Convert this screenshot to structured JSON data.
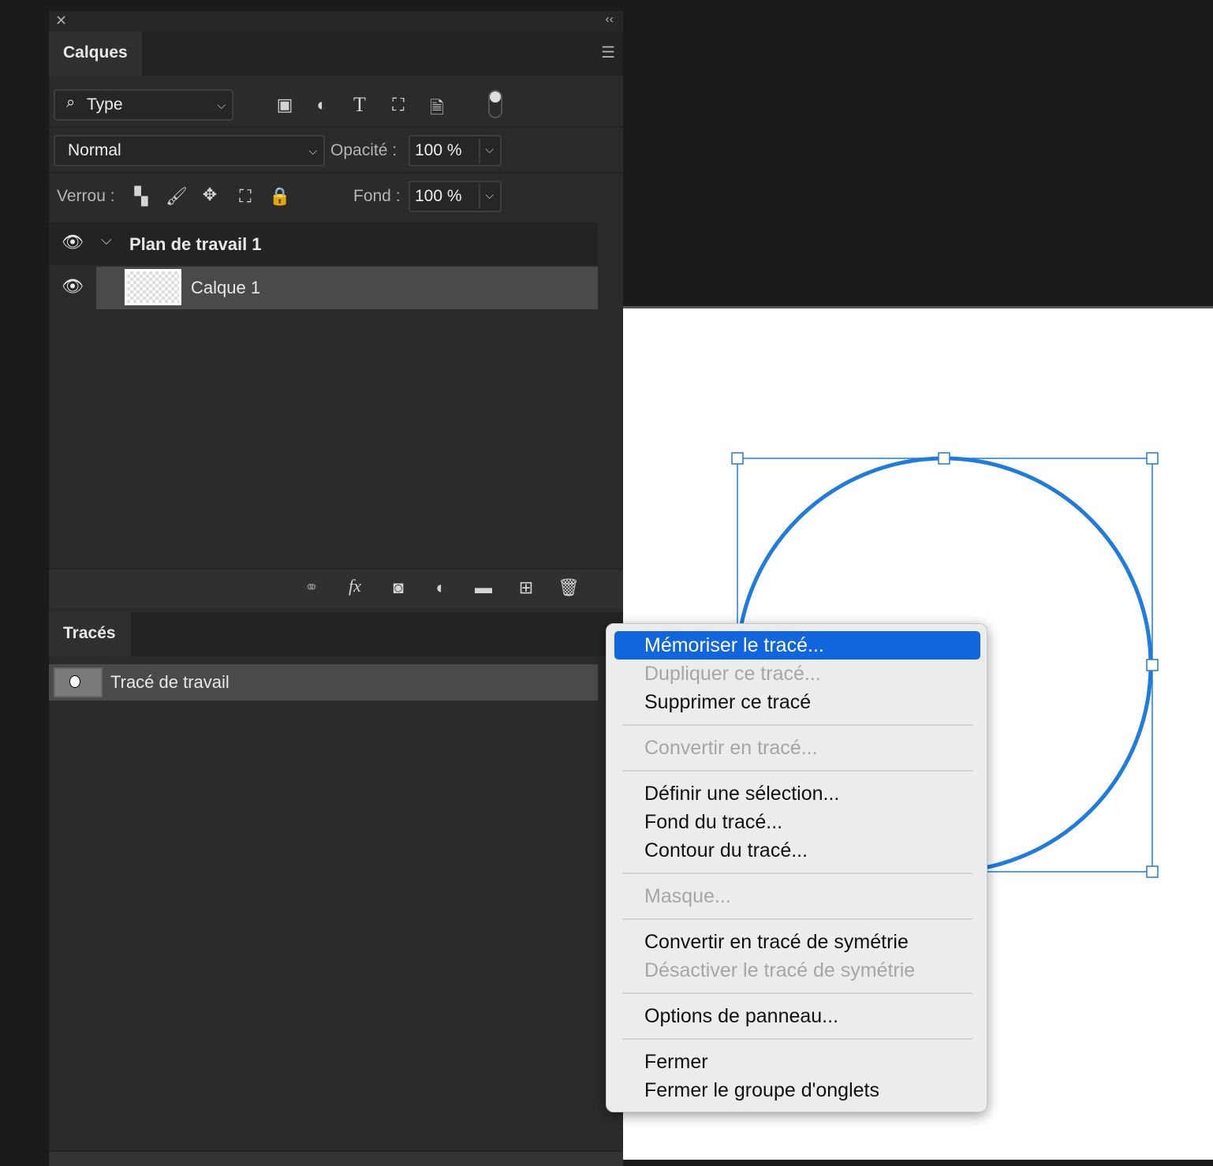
{
  "layers_panel": {
    "tab": "Calques",
    "filter": "Type",
    "blend_mode": "Normal",
    "opacity_label": "Opacité :",
    "opacity": "100 %",
    "lock_label": "Verrou :",
    "fill_label": "Fond :",
    "fill": "100 %",
    "layers": [
      {
        "name": "Plan de travail 1"
      },
      {
        "name": "Calque 1"
      }
    ]
  },
  "paths_panel": {
    "tab": "Tracés",
    "paths": [
      {
        "name": "Tracé de travail"
      }
    ]
  },
  "context_menu": {
    "items": [
      {
        "label": "Mémoriser le tracé...",
        "state": "highlighted"
      },
      {
        "label": "Dupliquer ce tracé...",
        "state": "disabled"
      },
      {
        "label": "Supprimer ce tracé",
        "state": "enabled"
      },
      {
        "label": "Convertir en tracé...",
        "state": "disabled"
      },
      {
        "label": "Définir une sélection...",
        "state": "enabled"
      },
      {
        "label": "Fond du tracé...",
        "state": "enabled"
      },
      {
        "label": "Contour du tracé...",
        "state": "enabled"
      },
      {
        "label": "Masque...",
        "state": "disabled"
      },
      {
        "label": "Convertir en tracé de symétrie",
        "state": "enabled"
      },
      {
        "label": "Désactiver le tracé de symétrie",
        "state": "disabled"
      },
      {
        "label": "Options de panneau...",
        "state": "enabled"
      },
      {
        "label": "Fermer",
        "state": "enabled"
      },
      {
        "label": "Fermer le groupe d'onglets",
        "state": "enabled"
      }
    ]
  },
  "colors": {
    "accent": "#1166dd",
    "path_stroke": "#1e7be0"
  }
}
